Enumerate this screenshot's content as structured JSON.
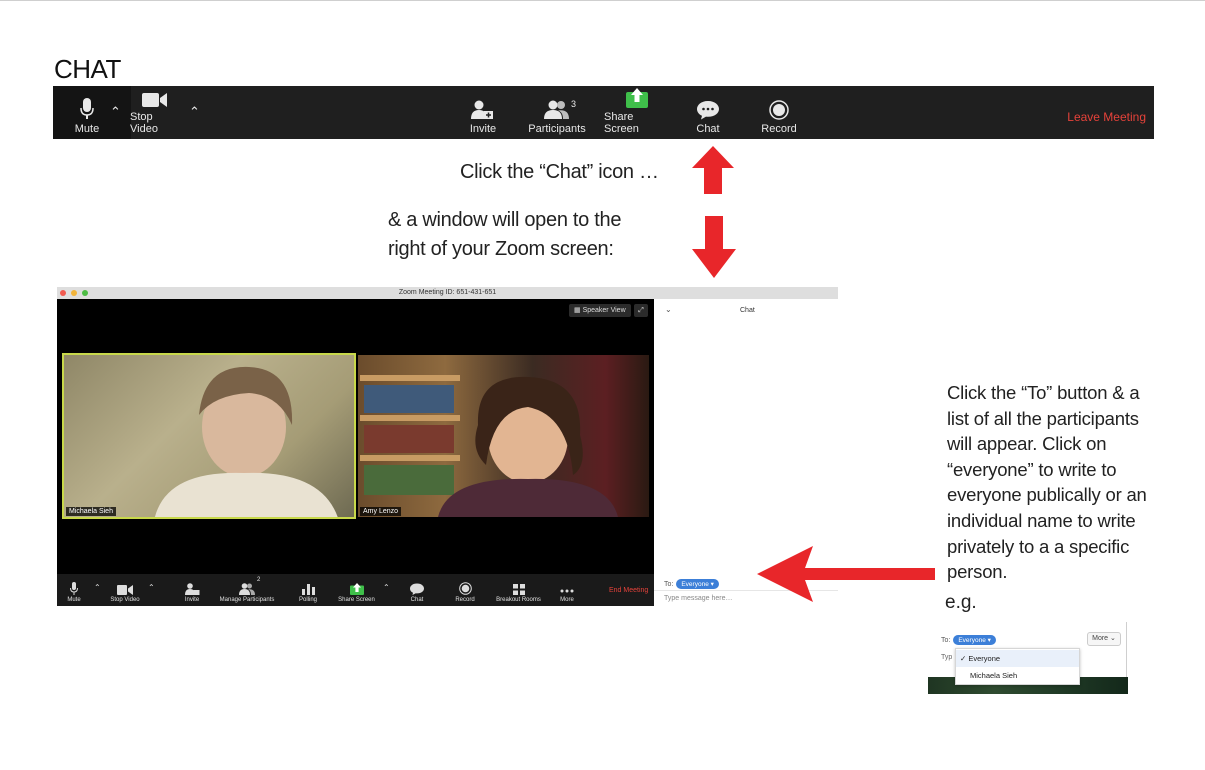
{
  "section_title": "CHAT",
  "toolbar": {
    "mute": "Mute",
    "stop_video": "Stop Video",
    "invite": "Invite",
    "participants": "Participants",
    "participants_count": "3",
    "share_screen": "Share Screen",
    "chat": "Chat",
    "record": "Record",
    "leave": "Leave Meeting"
  },
  "captions": {
    "click_chat": "Click the “Chat” icon …",
    "window_line1": "& a window will open to the",
    "window_line2": "right of your Zoom screen:"
  },
  "meeting": {
    "title": "Zoom Meeting ID: 651-431-651",
    "speaker_view": "Speaker View",
    "participant1": "Michaela Sieh",
    "participant2": "Amy Lenzo",
    "chat_title": "Chat",
    "to_label": "To:",
    "to_value": "Everyone ▾",
    "input_placeholder": "Type message here…",
    "toolbar": {
      "mute": "Mute",
      "stop_video": "Stop Video",
      "invite": "Invite",
      "manage_participants": "Manage Participants",
      "participants_count": "2",
      "polling": "Polling",
      "share_screen": "Share Screen",
      "chat": "Chat",
      "record": "Record",
      "breakout_rooms": "Breakout Rooms",
      "more": "More",
      "end_meeting": "End Meeting"
    }
  },
  "right_note": {
    "lines": [
      "Click the “To” button & a",
      "list of all the participants",
      "will appear. Click on",
      "“everyone” to write to",
      "everyone publically or an",
      "individual name to write",
      "privately to a a specific",
      "person."
    ],
    "eg": "e.g."
  },
  "example": {
    "to_label": "To:",
    "to_value": "Everyone ▾",
    "more": "More ⌄",
    "typ": "Typ",
    "options": [
      "✓ Everyone",
      "Michaela Sieh"
    ]
  },
  "colors": {
    "arrow_red": "#e8262a",
    "leave_red": "#e5423a",
    "share_green": "#3fbf4a",
    "pill_blue": "#3c7fd8"
  }
}
